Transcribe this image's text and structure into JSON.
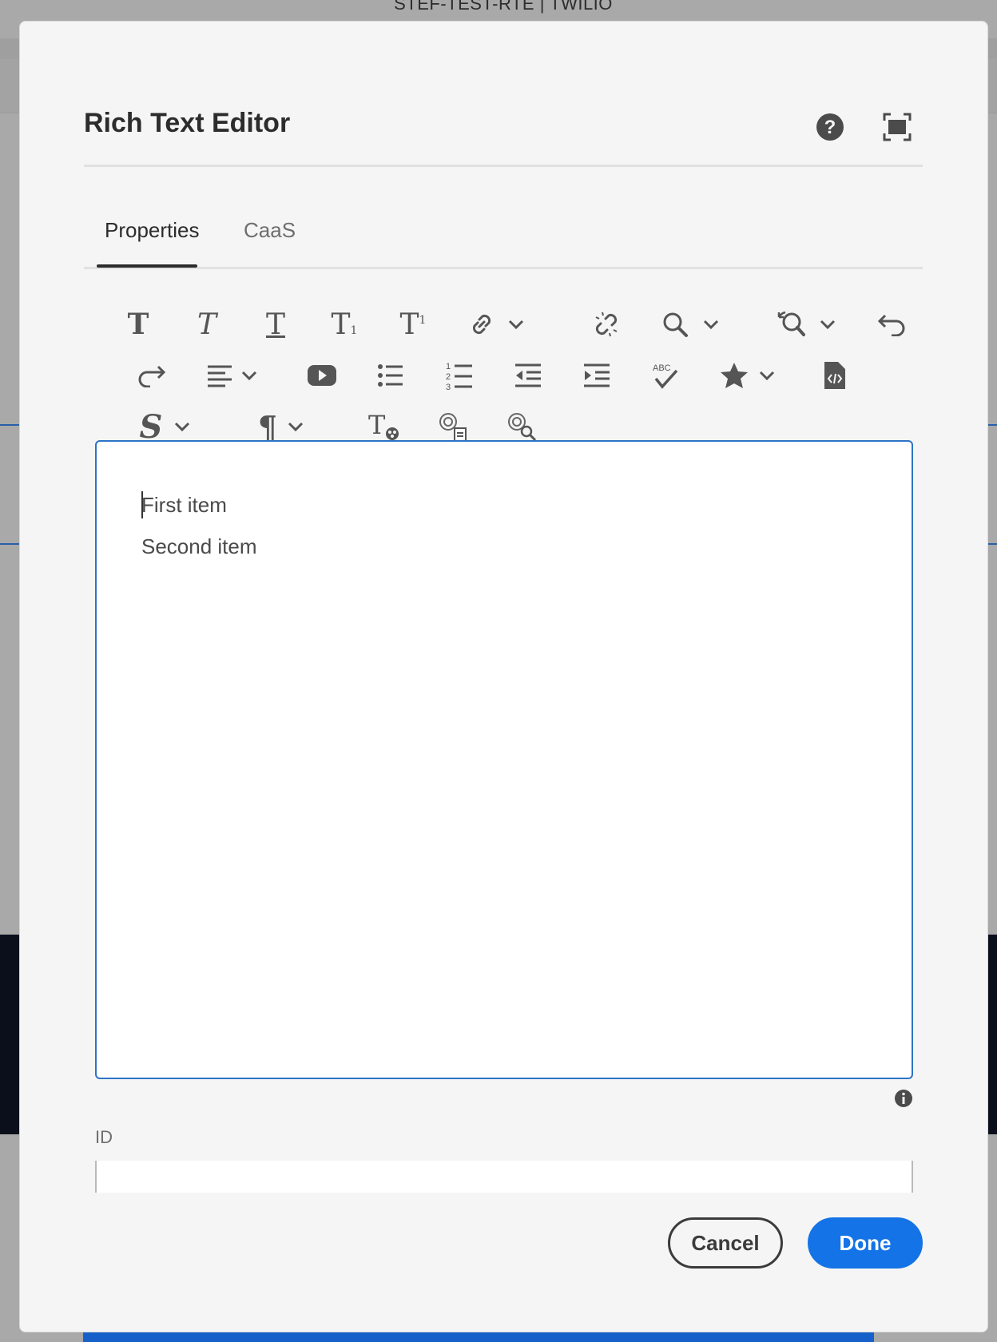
{
  "background": {
    "window_title": "STEF-TEST-RTE | TWILIO"
  },
  "modal": {
    "title": "Rich Text Editor",
    "tabs": [
      {
        "label": "Properties",
        "active": true
      },
      {
        "label": "CaaS",
        "active": false
      }
    ],
    "toolbar": {
      "icons": [
        "bold-icon",
        "italic-icon",
        "underline-icon",
        "subscript-icon",
        "superscript-icon",
        "link-icon",
        "unlink-icon",
        "find-icon",
        "find-replace-icon",
        "undo-icon",
        "redo-icon",
        "align-icon",
        "video-icon",
        "bullet-list-icon",
        "numbered-list-icon",
        "outdent-icon",
        "indent-icon",
        "spellcheck-icon",
        "star-icon",
        "source-edit-icon",
        "styles-icon",
        "paragraph-format-icon",
        "text-style-icon",
        "ai-generate-icon",
        "ai-search-icon"
      ]
    },
    "editor": {
      "lines": [
        "First item",
        "Second item"
      ]
    },
    "id_field": {
      "label": "ID",
      "value": ""
    },
    "buttons": {
      "cancel": "Cancel",
      "done": "Done"
    },
    "colors": {
      "accent": "#1473e6",
      "editor_border": "#2d73c6"
    }
  }
}
